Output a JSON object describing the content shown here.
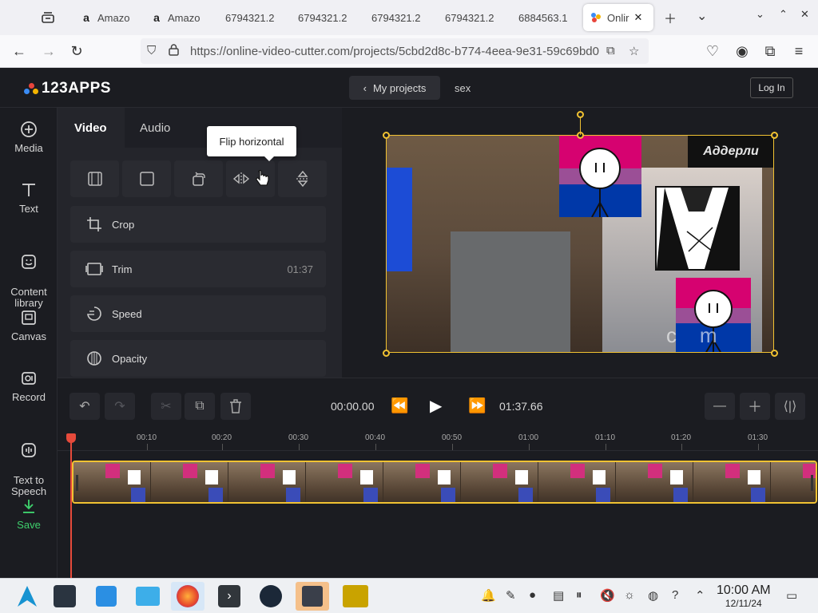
{
  "browser": {
    "tabs": [
      {
        "label": "Amazo",
        "favicon": "a"
      },
      {
        "label": "Amazo",
        "favicon": "a"
      },
      {
        "label": "6794321.2",
        "favicon": ""
      },
      {
        "label": "6794321.2",
        "favicon": ""
      },
      {
        "label": "6794321.2",
        "favicon": ""
      },
      {
        "label": "6794321.2",
        "favicon": ""
      },
      {
        "label": "6884563.1",
        "favicon": ""
      },
      {
        "label": "Onlir",
        "favicon": "123apps"
      }
    ],
    "url": "https://online-video-cutter.com/projects/5cbd2d8c-b774-4eea-9e31-59c69bd0"
  },
  "app": {
    "logo_text": "123APPS",
    "my_projects_label": "My projects",
    "project_name": "sex",
    "login_label": "Log In",
    "accent_color": "#f1c232",
    "save_color": "#3ecf6c"
  },
  "sidebar": {
    "items": [
      {
        "label": "Media",
        "icon": "plus-circle-icon"
      },
      {
        "label": "Text",
        "icon": "text-icon"
      },
      {
        "label": "Content\nlibrary",
        "icon": "sticker-icon"
      },
      {
        "label": "Canvas",
        "icon": "canvas-icon"
      },
      {
        "label": "Record",
        "icon": "record-icon"
      },
      {
        "label": "Text to\nSpeech",
        "icon": "speech-icon"
      },
      {
        "label": "Save",
        "icon": "download-icon"
      }
    ]
  },
  "panel": {
    "tabs": [
      {
        "label": "Video"
      },
      {
        "label": "Audio"
      }
    ],
    "tooltip": "Flip horizontal",
    "rows": [
      {
        "label": "Crop",
        "value": ""
      },
      {
        "label": "Trim",
        "value": "01:37"
      },
      {
        "label": "Speed",
        "value": ""
      },
      {
        "label": "Opacity",
        "value": ""
      }
    ]
  },
  "preview": {
    "overlay_text": "Аддерли",
    "watermark": "c    m"
  },
  "transport": {
    "current_time": "00:00.00",
    "duration": "01:37.66"
  },
  "timeline": {
    "ticks": [
      "00:10",
      "00:20",
      "00:30",
      "00:40",
      "00:50",
      "01:00",
      "01:10",
      "01:20",
      "01:30"
    ]
  },
  "taskbar": {
    "time": "10:00 AM",
    "date": "12/11/24"
  }
}
